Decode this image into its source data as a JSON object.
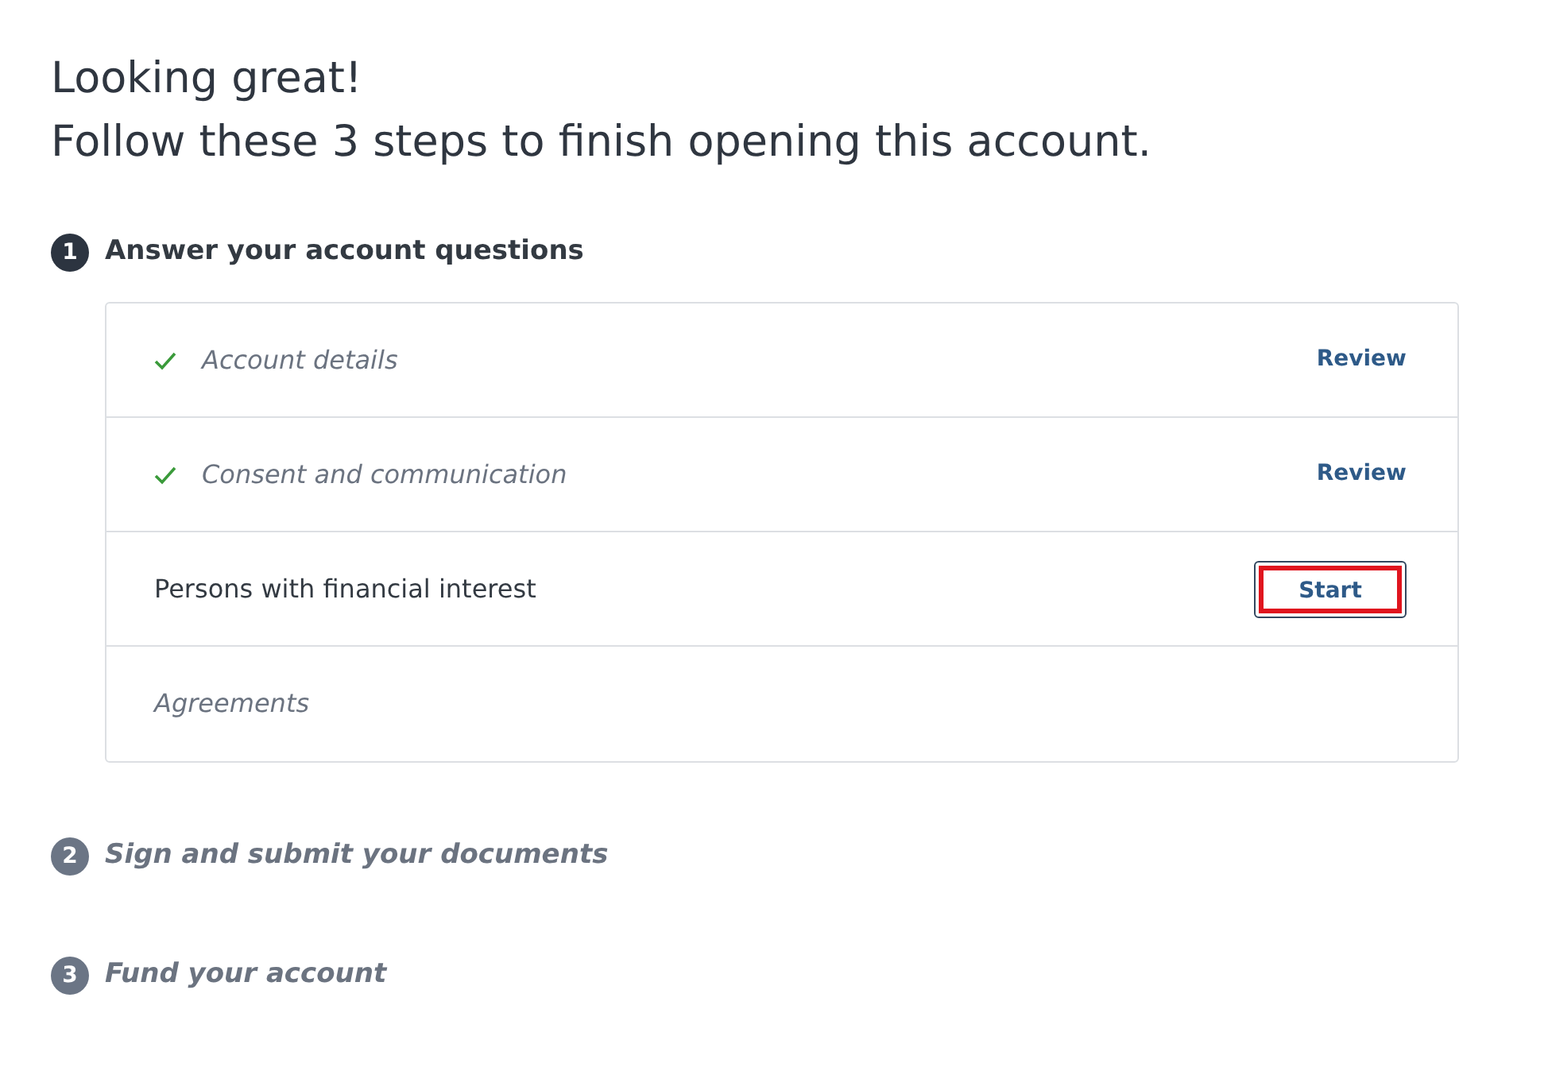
{
  "heading": [
    "Looking great!",
    "Follow these 3 steps to finish opening this account."
  ],
  "steps": [
    {
      "number": "1",
      "title": "Answer your account questions",
      "active": true,
      "tasks": [
        {
          "label": "Account details",
          "kind": "done",
          "action": {
            "label": "Review",
            "focused": false
          }
        },
        {
          "label": "Consent and communication",
          "kind": "done",
          "action": {
            "label": "Review",
            "focused": false
          }
        },
        {
          "label": "Persons with financial interest",
          "kind": "current",
          "action": {
            "label": "Start",
            "focused": true
          }
        },
        {
          "label": "Agreements",
          "kind": "pending"
        }
      ]
    },
    {
      "number": "2",
      "title": "Sign and submit your documents",
      "active": false
    },
    {
      "number": "3",
      "title": "Fund your account",
      "active": false
    }
  ]
}
